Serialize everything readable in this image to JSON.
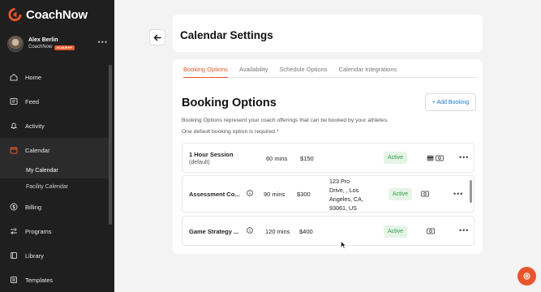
{
  "app": {
    "name": "CoachNow"
  },
  "user": {
    "name": "Alex Berlin",
    "org": "CoachNow",
    "badge": "ACADEMY"
  },
  "nav": [
    {
      "label": "Home",
      "icon": "home-icon"
    },
    {
      "label": "Feed",
      "icon": "feed-icon"
    },
    {
      "label": "Activity",
      "icon": "bell-icon"
    },
    {
      "label": "Calendar",
      "icon": "calendar-icon"
    },
    {
      "label": "Billing",
      "icon": "dollar-icon"
    },
    {
      "label": "Programs",
      "icon": "programs-icon"
    },
    {
      "label": "Library",
      "icon": "library-icon"
    },
    {
      "label": "Templates",
      "icon": "templates-icon"
    }
  ],
  "calendar_sub": [
    "My Calendar",
    "Facility Calendar"
  ],
  "page": {
    "title": "Calendar Settings"
  },
  "tabs": [
    "Booking Options",
    "Availability",
    "Schedule Options",
    "Calendar Integrations"
  ],
  "section": {
    "title": "Booking Options",
    "add_button": "+ Add Booking",
    "desc1": "Booking Options represent your coach offerings that can be booked by your athletes.",
    "desc2": "One default booking option is required.*"
  },
  "bookings": [
    {
      "name": "1 Hour Session",
      "sub": "(default)",
      "duration": "60 mins",
      "price": "$150",
      "location": "",
      "status": "Active"
    },
    {
      "name": "Assessment Co...",
      "sub": "",
      "duration": "90 mins",
      "price": "$300",
      "location_lines": [
        "123 Pro",
        "Drive, , Los",
        "Angeles, CA,",
        "93061, US"
      ],
      "status": "Active"
    },
    {
      "name": "Game Strategy ...",
      "sub": "",
      "duration": "120 mins",
      "price": "$400",
      "location": "",
      "status": "Active"
    }
  ],
  "colors": {
    "accent": "#e8552a",
    "link": "#1d79c9",
    "active_bg": "#e5f4e5",
    "active_text": "#2e9a45"
  }
}
